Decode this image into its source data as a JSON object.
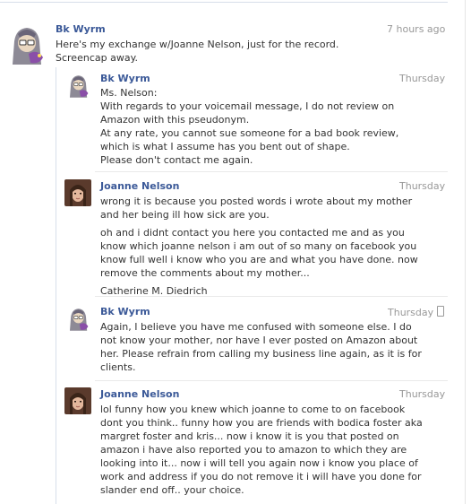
{
  "post": {
    "author": "Bk Wyrm",
    "time": "7 hours ago",
    "lines": [
      "Here's my exchange w/Joanne Nelson, just for the record.",
      "Screencap away."
    ]
  },
  "messages": [
    {
      "author": "Bk Wyrm",
      "time": "Thursday",
      "paragraphs": [
        [
          "Ms. Nelson:",
          "With regards to your voicemail message, I do not review on",
          "Amazon with this pseudonym.",
          "At any rate, you cannot sue someone for a bad book review,",
          "which is what I assume has you bent out of shape.",
          "Please don't contact me again."
        ]
      ]
    },
    {
      "author": "Joanne Nelson",
      "time": "Thursday",
      "paragraphs": [
        [
          "wrong it is because you posted words i wrote about my mother",
          "and her being ill how sick are you."
        ],
        [
          "oh and i didnt contact you here you contacted me and as you",
          "know which joanne nelson i am out of so many on facebook you",
          "know full well i know who you are and what you have done. now",
          "remove the comments about my mother..."
        ],
        [
          "Catherine M. Diedrich"
        ]
      ]
    },
    {
      "author": "Bk Wyrm",
      "time": "Thursday",
      "paragraphs": [
        [
          "Again, I believe you have me confused with someone else. I do",
          "not know your mother, nor have I ever posted on Amazon about",
          "her. Please refrain from calling my business line again, as it is for",
          "clients."
        ]
      ]
    },
    {
      "author": "Joanne Nelson",
      "time": "Thursday",
      "paragraphs": [
        [
          "lol funny how you knew which joanne to come to on facebook",
          "dont you think.. funny how you are friends with bodica foster aka",
          "margret foster and kris... now i know it is you that posted on",
          "amazon i have also reported you to amazon to which they are",
          "looking into it... now i will tell you again now i know you place of",
          "work and address if you do not remove it i will have you done for",
          "slander end off.. your choice."
        ]
      ]
    }
  ],
  "colors": {
    "link": "#3b5998",
    "time": "#999999",
    "text": "#333333",
    "separator": "#e9e9e9",
    "avatar_bkwyrm_bg": "#c9c2d8",
    "avatar_joanne_bg": "#5a3a2c"
  }
}
